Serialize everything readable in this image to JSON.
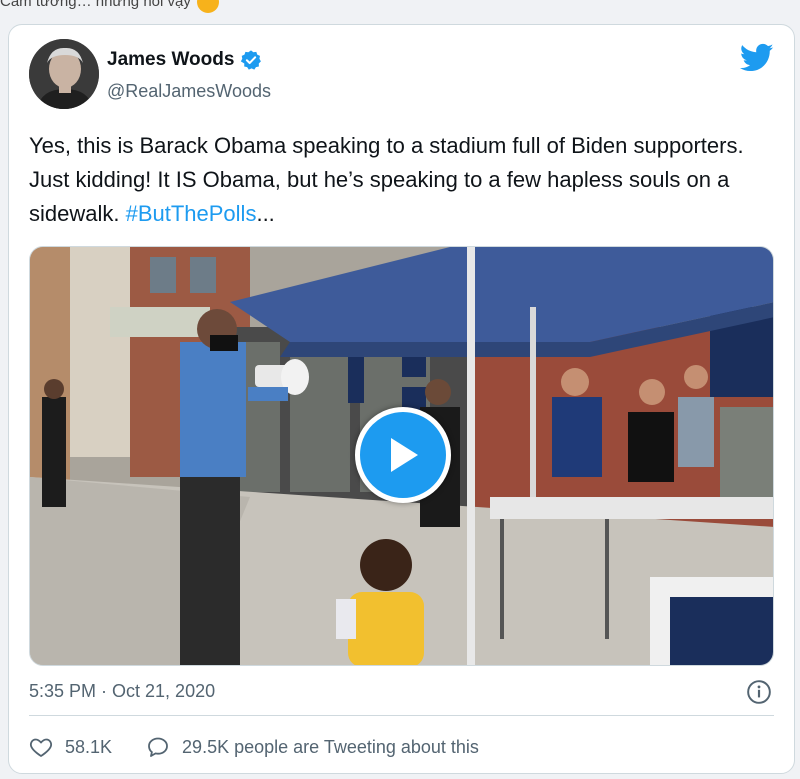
{
  "page": {
    "top_text": "Cảm tưởng… nhưng nói vậy"
  },
  "tweet": {
    "author_name": "James Woods",
    "author_handle": "@RealJamesWoods",
    "text_main": "Yes, this is Barack Obama speaking to a stadium full of Biden supporters. Just kidding! It IS Obama, but he’s speaking to a few hapless souls on a sidewalk. ",
    "hashtag": "#ButThePolls",
    "ellipsis": "...",
    "timestamp": "5:35 PM · Oct 21, 2020",
    "likes": "58.1K",
    "tweeting_text": "29.5K people are Tweeting about this"
  },
  "colors": {
    "accent": "#1d9bf0",
    "verified": "#1d9bf0",
    "muted": "#536471"
  },
  "icons": {
    "verified": "verified-badge-icon",
    "twitter": "twitter-bird-icon",
    "play": "play-icon",
    "info": "info-icon",
    "heart": "heart-icon",
    "reply": "speech-bubble-icon"
  }
}
